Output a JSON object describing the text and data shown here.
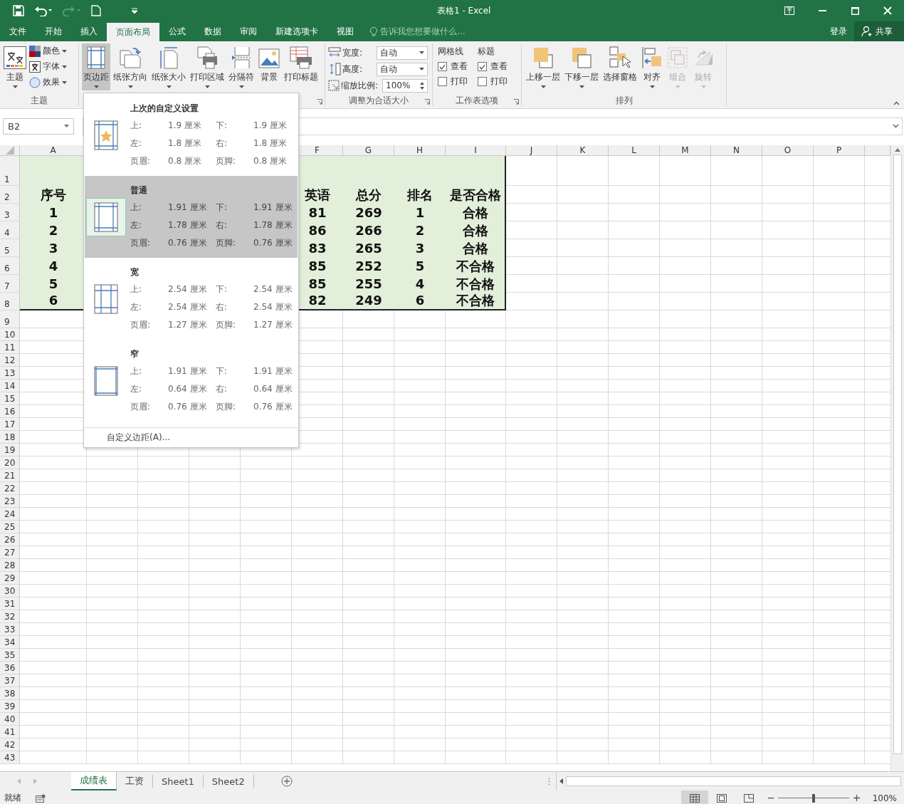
{
  "title_bar": {
    "title": "表格1 - Excel"
  },
  "menu_tabs": [
    {
      "label": "文件",
      "selected": false
    },
    {
      "label": "开始",
      "selected": false
    },
    {
      "label": "插入",
      "selected": false
    },
    {
      "label": "页面布局",
      "selected": true
    },
    {
      "label": "公式",
      "selected": false
    },
    {
      "label": "数据",
      "selected": false
    },
    {
      "label": "审阅",
      "selected": false
    },
    {
      "label": "新建选项卡",
      "selected": false
    },
    {
      "label": "视图",
      "selected": false
    }
  ],
  "tell_me": {
    "placeholder": "告诉我您想要做什么..."
  },
  "account": {
    "sign_in": "登录",
    "share": "共享"
  },
  "ribbon": {
    "themes": {
      "label": "主题",
      "theme_button": "主题",
      "options": [
        {
          "kind": "colors",
          "label": "颜色"
        },
        {
          "kind": "fonts",
          "label": "字体"
        },
        {
          "kind": "effects",
          "label": "效果"
        }
      ]
    },
    "page_setup": {
      "buttons": [
        {
          "kind": "margins",
          "label": "页边距",
          "pressed": true
        },
        {
          "kind": "orientation",
          "label": "纸张方向",
          "pressed": false
        },
        {
          "kind": "size",
          "label": "纸张大小",
          "pressed": false
        },
        {
          "kind": "print_area",
          "label": "打印区域",
          "pressed": false
        },
        {
          "kind": "breaks",
          "label": "分隔符",
          "pressed": false
        },
        {
          "kind": "background",
          "label": "背景",
          "pressed": false
        },
        {
          "kind": "print_titles",
          "label": "打印标题",
          "pressed": false
        }
      ]
    },
    "scale_to_fit": {
      "label": "调整为合适大小",
      "fields": [
        {
          "kind": "width",
          "label": "宽度:",
          "value": "自动"
        },
        {
          "kind": "height",
          "label": "高度:",
          "value": "自动"
        },
        {
          "kind": "scale",
          "label": "缩放比例:",
          "value": "100%"
        }
      ]
    },
    "sheet_options": {
      "label": "工作表选项",
      "columns": [
        {
          "title": "网格线",
          "items": [
            {
              "label": "查看",
              "checked": true
            },
            {
              "label": "打印",
              "checked": false
            }
          ]
        },
        {
          "title": "标题",
          "items": [
            {
              "label": "查看",
              "checked": true
            },
            {
              "label": "打印",
              "checked": false
            }
          ]
        }
      ]
    },
    "arrange": {
      "label": "排列",
      "buttons": [
        {
          "kind": "bring_forward",
          "label": "上移一层",
          "disabled": false
        },
        {
          "kind": "send_backward",
          "label": "下移一层",
          "disabled": false
        },
        {
          "kind": "selection_pane",
          "label": "选择窗格",
          "disabled": false
        },
        {
          "kind": "align",
          "label": "对齐",
          "disabled": false
        },
        {
          "kind": "group",
          "label": "组合",
          "disabled": true
        },
        {
          "kind": "rotate",
          "label": "旋转",
          "disabled": true
        }
      ]
    }
  },
  "formula_bar": {
    "name_box": "B2"
  },
  "sheet": {
    "column_headers": [
      "A",
      "F",
      "G",
      "H",
      "I",
      "J",
      "K",
      "L",
      "M",
      "N",
      "O",
      "P"
    ],
    "row_numbers": [
      "1",
      "2",
      "3",
      "4",
      "5",
      "6",
      "7",
      "8",
      "9",
      "10",
      "11",
      "12",
      "13",
      "14",
      "15",
      "16",
      "17",
      "18",
      "19",
      "20",
      "21",
      "22",
      "23",
      "24",
      "25",
      "26",
      "27",
      "28",
      "29",
      "30",
      "31",
      "32",
      "33",
      "34",
      "35",
      "36",
      "37",
      "38",
      "39",
      "40",
      "41",
      "42",
      "43"
    ],
    "header": [
      "序号",
      "英语",
      "总分",
      "排名",
      "是否合格"
    ],
    "rows": [
      [
        "1",
        "81",
        "269",
        "1",
        "合格"
      ],
      [
        "2",
        "86",
        "266",
        "2",
        "合格"
      ],
      [
        "3",
        "83",
        "265",
        "3",
        "合格"
      ],
      [
        "4",
        "85",
        "252",
        "5",
        "不合格"
      ],
      [
        "5",
        "85",
        "255",
        "4",
        "不合格"
      ],
      [
        "6",
        "82",
        "249",
        "6",
        "不合格"
      ]
    ]
  },
  "margins_menu": {
    "presets": [
      {
        "kind": "custom",
        "title": "上次的自定义设置",
        "selected": false,
        "values": [
          {
            "label": "上:",
            "value": "1.9 厘米"
          },
          {
            "label": "下:",
            "value": "1.9 厘米"
          },
          {
            "label": "左:",
            "value": "1.8 厘米"
          },
          {
            "label": "右:",
            "value": "1.8 厘米"
          },
          {
            "label": "页眉:",
            "value": "0.8 厘米"
          },
          {
            "label": "页脚:",
            "value": "0.8 厘米"
          }
        ]
      },
      {
        "kind": "normal",
        "title": "普通",
        "selected": true,
        "values": [
          {
            "label": "上:",
            "value": "1.91 厘米"
          },
          {
            "label": "下:",
            "value": "1.91 厘米"
          },
          {
            "label": "左:",
            "value": "1.78 厘米"
          },
          {
            "label": "右:",
            "value": "1.78 厘米"
          },
          {
            "label": "页眉:",
            "value": "0.76 厘米"
          },
          {
            "label": "页脚:",
            "value": "0.76 厘米"
          }
        ]
      },
      {
        "kind": "wide",
        "title": "宽",
        "selected": false,
        "values": [
          {
            "label": "上:",
            "value": "2.54 厘米"
          },
          {
            "label": "下:",
            "value": "2.54 厘米"
          },
          {
            "label": "左:",
            "value": "2.54 厘米"
          },
          {
            "label": "右:",
            "value": "2.54 厘米"
          },
          {
            "label": "页眉:",
            "value": "1.27 厘米"
          },
          {
            "label": "页脚:",
            "value": "1.27 厘米"
          }
        ]
      },
      {
        "kind": "narrow",
        "title": "窄",
        "selected": false,
        "values": [
          {
            "label": "上:",
            "value": "1.91 厘米"
          },
          {
            "label": "下:",
            "value": "1.91 厘米"
          },
          {
            "label": "左:",
            "value": "0.64 厘米"
          },
          {
            "label": "右:",
            "value": "0.64 厘米"
          },
          {
            "label": "页眉:",
            "value": "0.76 厘米"
          },
          {
            "label": "页脚:",
            "value": "0.76 厘米"
          }
        ]
      }
    ],
    "custom": "自定义边距(A)..."
  },
  "sheet_tabs": [
    {
      "label": "成绩表",
      "selected": true
    },
    {
      "label": "工资",
      "selected": false
    },
    {
      "label": "Sheet1",
      "selected": false
    },
    {
      "label": "Sheet2",
      "selected": false
    }
  ],
  "status_bar": {
    "status": "就绪",
    "views": [
      {
        "kind": "normal",
        "selected": true
      },
      {
        "kind": "page_layout",
        "selected": false
      },
      {
        "kind": "page_break",
        "selected": false
      }
    ],
    "zoom_slider": {
      "level": 0.5
    },
    "zoom": "100%"
  }
}
